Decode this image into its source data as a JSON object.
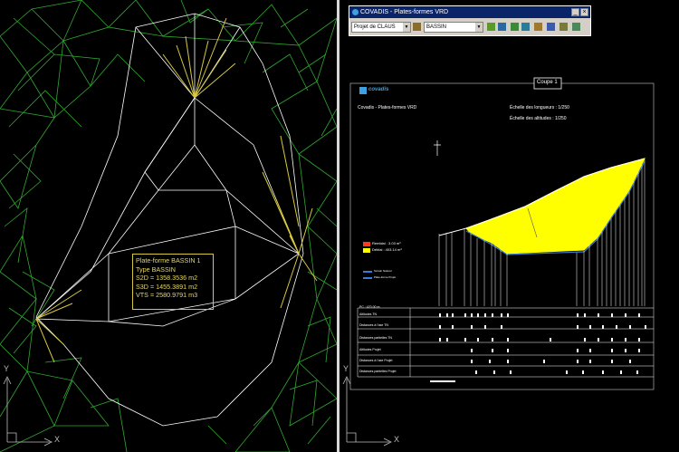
{
  "left_view": {
    "info_box": {
      "title": "Plate-forme BASSIN 1",
      "type": "Type BASSIN",
      "s2d": "S2D = 1358.3536 m2",
      "s3d": "S3D = 1455.3891 m2",
      "vts": "VTS = 2580.9791 m3"
    },
    "ucs_x": "X",
    "ucs_y": "Y"
  },
  "toolbar": {
    "title": "COVADIS - Plates-formes VRD",
    "project_combo": "Projet de CLAUS",
    "platform_combo": "BASSIN"
  },
  "sheet": {
    "title": "Coupe 1",
    "logo_text": "covadis",
    "company": "Covadis - Plates-formes VRD",
    "scale_lengths": "Échelle des longueurs : 1/250",
    "scale_heights": "Échelle des altitudes : 1/250",
    "legend_remblai": "Remblai : 3.03 m³",
    "legend_deblai": "Déblai : 403.14 m³",
    "legend_line1": "Terrain Naturel",
    "legend_line2": "Plate-forme Projet",
    "pc_label": "PC : 470.00 m",
    "rows": [
      "Altitudes TN",
      "Distances à l'axe TN",
      "Distances partielles TN",
      "Altitudes Projet",
      "Distances à l'axe Projet",
      "Distances partielles Projet"
    ],
    "ucs_x": "X",
    "ucs_y": "Y",
    "colors": {
      "fill": "#ffff00",
      "profile": "#ffffff",
      "project_line": "#3a7bd5"
    }
  }
}
